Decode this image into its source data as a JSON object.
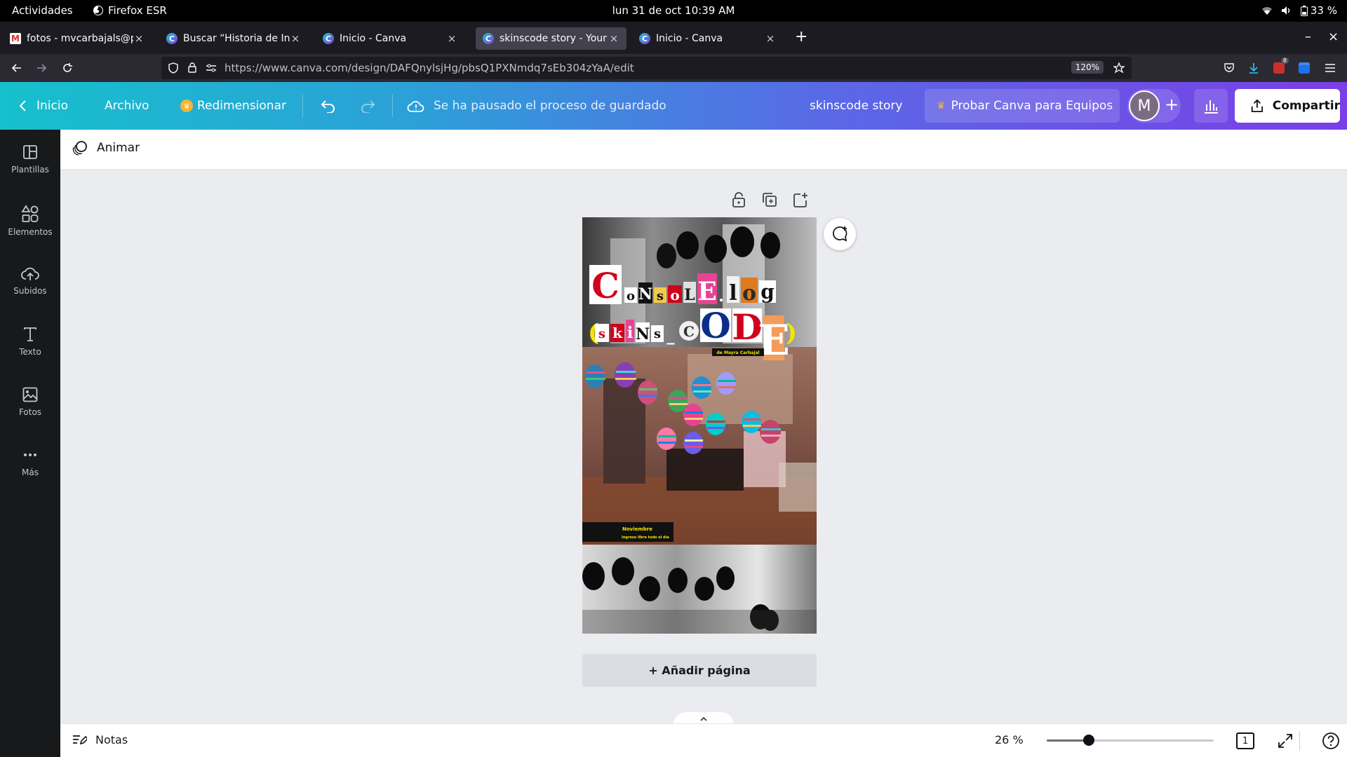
{
  "system": {
    "activities": "Actividades",
    "app_name": "Firefox ESR",
    "clock": "lun 31 de oct  10:39 AM",
    "battery": "33 %"
  },
  "browser": {
    "tabs": [
      {
        "title": "fotos - mvcarbajals@pucp",
        "favicon": "gmail-icon",
        "active": false
      },
      {
        "title": "Buscar “Historia de Instag",
        "favicon": "canva-icon",
        "active": false
      },
      {
        "title": "Inicio - Canva",
        "favicon": "canva-icon",
        "active": false
      },
      {
        "title": "skinscode story - Your Sto",
        "favicon": "canva-icon",
        "active": true
      },
      {
        "title": "Inicio - Canva",
        "favicon": "canva-icon",
        "active": false
      }
    ],
    "url": "https://www.canva.com/design/DAFQnylsjHg/pbsQ1PXNmdq7sEb304zYaA/edit",
    "zoom": "120%",
    "download_badge": "8"
  },
  "canva_header": {
    "home_label": "Inicio",
    "file_label": "Archivo",
    "resize_label": "Redimensionar",
    "save_status": "Se ha pausado el proceso de guardado",
    "design_title": "skinscode story",
    "teams_label": "Probar Canva para Equipos",
    "avatar_letter": "M",
    "share_label": "Compartir"
  },
  "sidebar": {
    "items": [
      {
        "label": "Plantillas",
        "icon": "templates-icon"
      },
      {
        "label": "Elementos",
        "icon": "elements-icon"
      },
      {
        "label": "Subidos",
        "icon": "upload-cloud-icon"
      },
      {
        "label": "Texto",
        "icon": "text-icon"
      },
      {
        "label": "Fotos",
        "icon": "photos-icon"
      },
      {
        "label": "Más",
        "icon": "more-dots-icon"
      }
    ]
  },
  "toolbar": {
    "animate_label": "Animar"
  },
  "design": {
    "title_line1": "CoNsOlE.log",
    "title_line2": "(skiNs_CODE)",
    "author": "de Mayra Carbajal",
    "date_line": "Noviembre",
    "entry_line": "Ingreso libre todo el día"
  },
  "workspace": {
    "add_page_label": "+ Añadir página"
  },
  "bottombar": {
    "notes_label": "Notas",
    "zoom_percent": "26 %",
    "zoom_level": 0.26,
    "page_count": "1"
  },
  "colors": {
    "canva_gradient_start": "#16c0cc",
    "canva_gradient_end": "#7a3fe6",
    "sidebar_bg": "#18191b",
    "workspace_bg": "#ebecf0"
  }
}
